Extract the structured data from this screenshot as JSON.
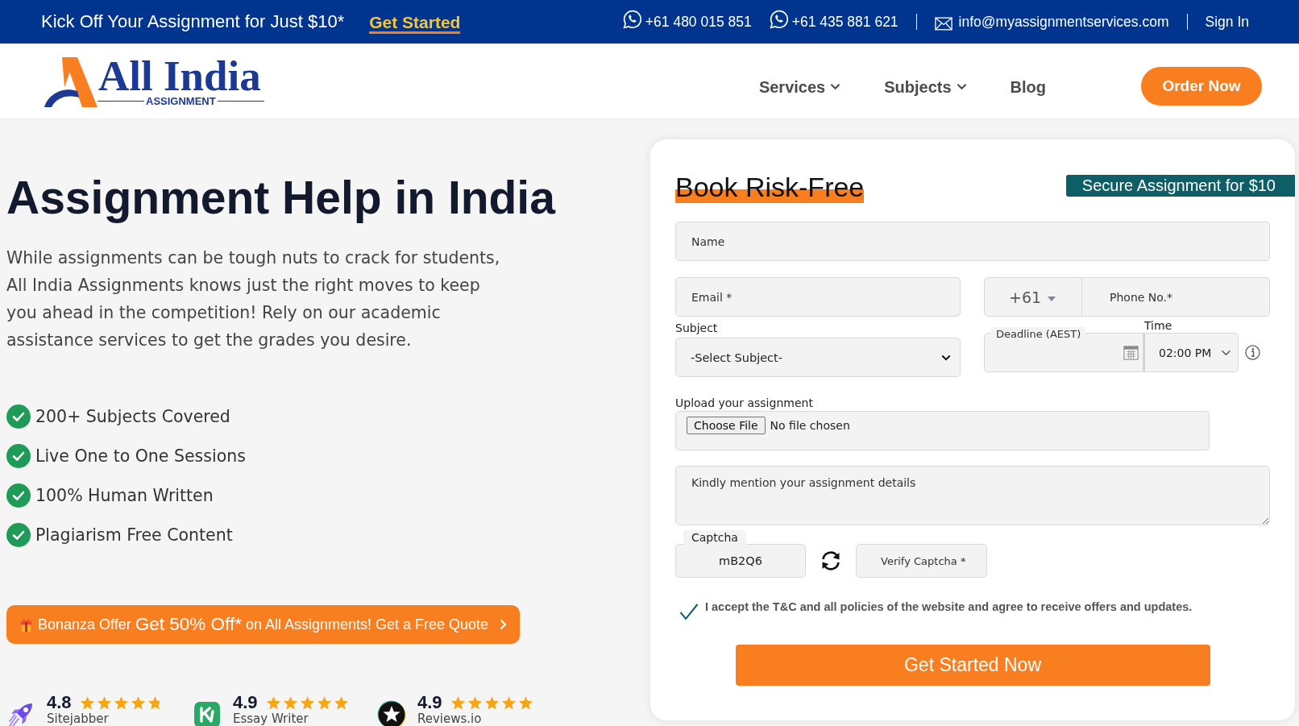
{
  "promo_bar": {
    "message": "Kick Off Your Assignment for Just $10*",
    "cta": "Get Started",
    "phones": [
      "+61 480 015 851",
      "+61 435 881 621"
    ],
    "email": "info@myassignmentservices.com",
    "sign_in": "Sign In"
  },
  "header": {
    "logo": {
      "name": "All India",
      "tagline": "ASSIGNMENT"
    },
    "nav": [
      {
        "label": "Services",
        "has_menu": true
      },
      {
        "label": "Subjects",
        "has_menu": true
      },
      {
        "label": "Blog",
        "has_menu": false
      }
    ],
    "order_button": "Order Now"
  },
  "hero": {
    "title": "Assignment Help in India",
    "description": "While assignments can be tough nuts to crack for students, All India Assignments knows just the right moves to keep you ahead in the competition! Rely on our academic assistance services to get the grades you desire.",
    "features": [
      "200+ Subjects Covered",
      "Live One to One Sessions",
      "100% Human Written",
      "Plagiarism Free Content"
    ],
    "offer": {
      "lead": "Bonanza Offer",
      "highlight": "Get 50% Off*",
      "tail": "on All Assignments! Get a Free Quote"
    },
    "ratings": [
      {
        "kind": "rocket",
        "score": "4.8",
        "stars": 4.8,
        "source": "Sitejabber"
      },
      {
        "kind": "tile",
        "score": "4.9",
        "stars": 4.9,
        "source": "Essay Writer"
      },
      {
        "kind": "star_badge",
        "score": "4.9",
        "stars": 5,
        "source": "Reviews.io"
      }
    ]
  },
  "booking_form": {
    "title": "Book Risk-Free",
    "badge": "Secure Assignment for $10",
    "name": {
      "placeholder": "Name"
    },
    "email": {
      "placeholder": "Email *"
    },
    "country_code": {
      "value": "+61"
    },
    "phone": {
      "placeholder": "Phone No.*"
    },
    "subject": {
      "label": "Subject",
      "value": "-Select Subject-"
    },
    "deadline": {
      "label": "Deadline (AEST)"
    },
    "time": {
      "label": "Time",
      "value": "02:00 PM"
    },
    "upload": {
      "label": "Upload your assignment",
      "button": "Choose File",
      "status": "No file chosen"
    },
    "details": {
      "placeholder": "Kindly mention your assignment details"
    },
    "captcha": {
      "label": "Captcha",
      "code": "mB2Q6"
    },
    "captcha_answer": {
      "placeholder": "Verify Captcha *"
    },
    "agreement": {
      "text": "I accept the T&C and all policies of the website and agree to receive offers and updates.",
      "checked": true
    },
    "submit": "Get Started Now"
  }
}
